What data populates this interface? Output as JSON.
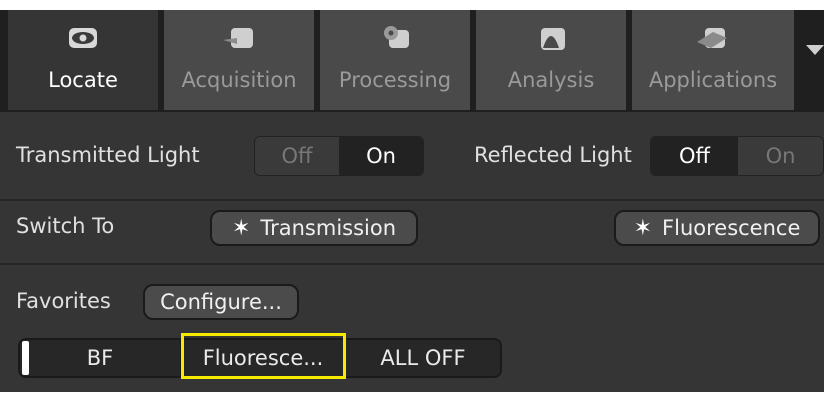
{
  "tabs": [
    {
      "label": "Locate",
      "icon": "eye-icon",
      "active": true
    },
    {
      "label": "Acquisition",
      "icon": "camera-icon",
      "active": false
    },
    {
      "label": "Processing",
      "icon": "gear-icon",
      "active": false
    },
    {
      "label": "Analysis",
      "icon": "histogram-icon",
      "active": false
    },
    {
      "label": "Applications",
      "icon": "apps-icon",
      "active": false
    }
  ],
  "light": {
    "transmitted_label": "Transmitted Light",
    "transmitted_off": "Off",
    "transmitted_on": "On",
    "transmitted_state": "On",
    "reflected_label": "Reflected Light",
    "reflected_off": "Off",
    "reflected_on": "On",
    "reflected_state": "Off"
  },
  "switch": {
    "label": "Switch To",
    "transmission": "Transmission",
    "fluorescence": "Fluorescence"
  },
  "favorites": {
    "label": "Favorites",
    "configure": "Configure...",
    "items": [
      "BF",
      "Fluoresce...",
      "ALL OFF"
    ],
    "highlighted_item": "Fluoresce..."
  },
  "colors": {
    "background": "#353535",
    "highlight": "#f5ea00"
  }
}
